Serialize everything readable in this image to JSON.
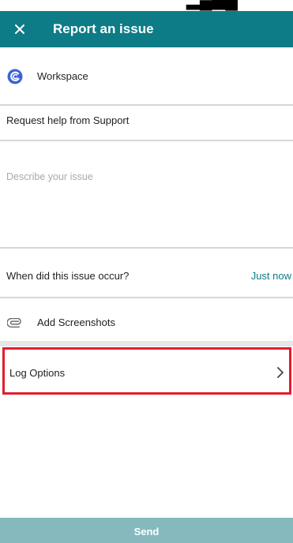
{
  "header": {
    "title": "Report an issue",
    "close_icon": "close-icon"
  },
  "workspace": {
    "label": "Workspace",
    "logo_icon": "workspace-logo-icon"
  },
  "subject": {
    "value": "Request help from Support"
  },
  "description": {
    "placeholder": "Describe your issue",
    "value": ""
  },
  "occurrence": {
    "label": "When did this issue occur?",
    "value": "Just now"
  },
  "screenshots": {
    "label": "Add Screenshots",
    "icon": "paperclip-icon"
  },
  "log_options": {
    "label": "Log Options",
    "icon": "chevron-right-icon",
    "highlighted": true
  },
  "send": {
    "label": "Send",
    "enabled": false
  },
  "colors": {
    "app_bar": "#0e7c86",
    "accent": "#0e7c86",
    "highlight_border": "#e11d2e",
    "send_disabled": "#85b9be"
  }
}
